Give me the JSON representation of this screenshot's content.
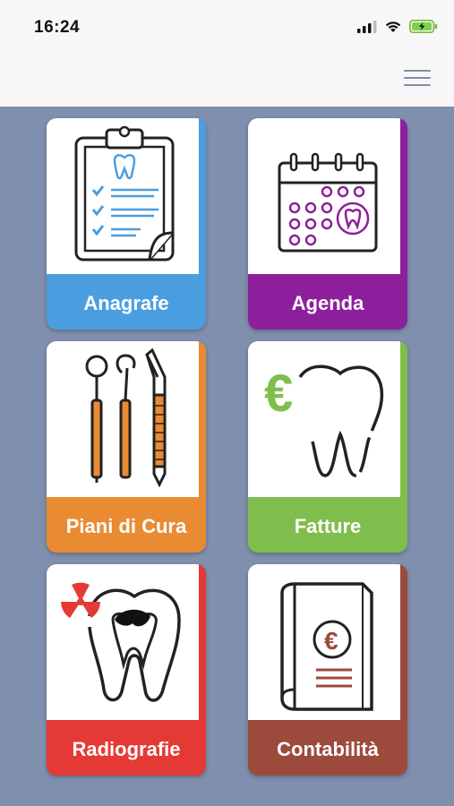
{
  "status": {
    "time": "16:24"
  },
  "header": {
    "menu_icon": "hamburger-menu-icon"
  },
  "colors": {
    "background": "#7f8fad",
    "anagrafe": "#4a9ee0",
    "agenda": "#8e1f9c",
    "piani": "#e98b32",
    "fatture": "#7fbe4c",
    "radiografie": "#e53935",
    "contabilita": "#9b4a3c"
  },
  "tiles": [
    {
      "label": "Anagrafe",
      "icon": "clipboard-tooth-icon"
    },
    {
      "label": "Agenda",
      "icon": "calendar-tooth-icon"
    },
    {
      "label": "Piani di Cura",
      "icon": "dental-tools-icon"
    },
    {
      "label": "Fatture",
      "icon": "tooth-euro-icon"
    },
    {
      "label": "Radiografie",
      "icon": "tooth-xray-icon"
    },
    {
      "label": "Contabilità",
      "icon": "ledger-euro-icon"
    }
  ]
}
